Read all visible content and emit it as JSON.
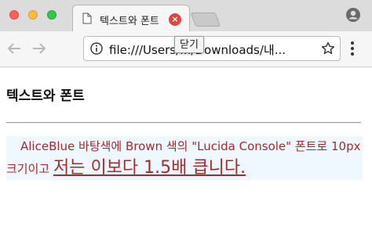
{
  "tab": {
    "title": "텍스트와 폰트",
    "close_symbol": "×"
  },
  "tooltip": "닫기",
  "address_bar": {
    "url": "file:///Users/.../Downloads/내..."
  },
  "page": {
    "heading": "텍스트와 폰트",
    "paragraph": "AliceBlue 바탕색에 Brown 색의 \"Lucida Console\" 폰트로 10px 크기이고 ",
    "emphasis": "저는 이보다 1.5배 큽니다."
  },
  "colors": {
    "paragraph_background": "#f0f8ff",
    "paragraph_text": "#a52a2a",
    "close_button": "#e0443e"
  },
  "icons": [
    "file-icon",
    "close-icon",
    "profile-icon",
    "back-icon",
    "forward-icon",
    "info-icon",
    "star-icon",
    "menu-icon"
  ]
}
